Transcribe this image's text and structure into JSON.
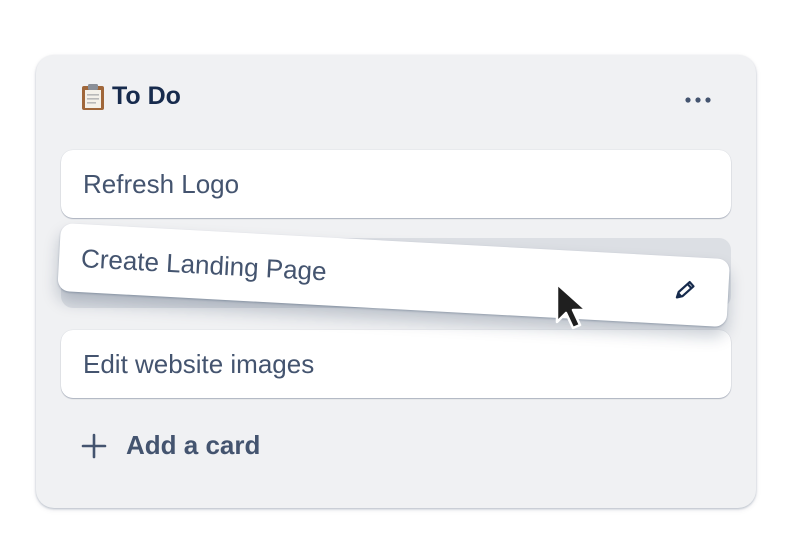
{
  "list": {
    "title": "To Do",
    "header_icon": "clipboard-icon",
    "menu_icon": "ellipsis-icon"
  },
  "cards": [
    {
      "title": "Refresh Logo"
    },
    {
      "title": "Create Landing Page",
      "state": "dragging",
      "action_icon": "pencil-icon"
    },
    {
      "title": "Edit website images"
    }
  ],
  "add_card": {
    "label": "Add a card",
    "icon": "plus-icon"
  },
  "colors": {
    "list_background": "#f0f1f3",
    "card_background": "#ffffff",
    "title_text": "#172b4d",
    "card_text": "#44546f",
    "placeholder": "#dcdfe4"
  }
}
